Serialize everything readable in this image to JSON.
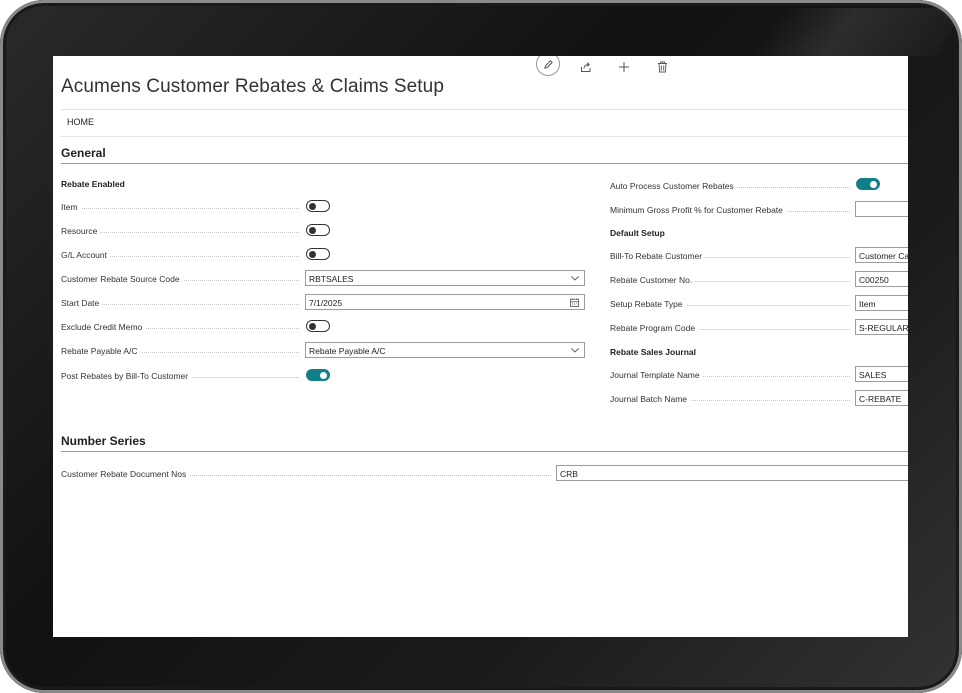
{
  "page": {
    "title": "Acumens Customer Rebates & Claims Setup",
    "tabs": [
      "HOME"
    ]
  },
  "toolbar": {
    "icons": [
      "edit-pencil-icon",
      "share-icon",
      "new-plus-icon",
      "delete-trash-icon"
    ]
  },
  "general": {
    "heading": "General",
    "left": {
      "group_heading": "Rebate Enabled",
      "item_label": "Item",
      "item_enabled": false,
      "resource_label": "Resource",
      "resource_enabled": false,
      "gl_account_label": "G/L Account",
      "gl_account_enabled": false,
      "source_code_label": "Customer Rebate Source Code",
      "source_code_value": "RBTSALES",
      "start_date_label": "Start Date",
      "start_date_value": "7/1/2025",
      "exclude_credit_memo_label": "Exclude Credit Memo",
      "exclude_credit_memo_enabled": false,
      "payable_ac_label": "Rebate Payable A/C",
      "payable_ac_value": "Rebate Payable A/C",
      "post_by_bill_to_label": "Post Rebates by Bill-To Customer",
      "post_by_bill_to_enabled": true
    },
    "right": {
      "auto_process_label": "Auto Process Customer Rebates",
      "auto_process_enabled": true,
      "min_gross_profit_label": "Minimum Gross Profit % for Customer Rebate",
      "min_gross_profit_value": "",
      "default_setup_heading": "Default Setup",
      "bill_to_label": "Bill-To Rebate Customer",
      "bill_to_value": "Customer Ca",
      "customer_no_label": "Rebate Customer No.",
      "customer_no_value": "C00250",
      "rebate_type_label": "Setup Rebate Type",
      "rebate_type_value": "Item",
      "program_code_label": "Rebate Program Code",
      "program_code_value": "S-REGULAR",
      "sales_journal_heading": "Rebate Sales Journal",
      "template_label": "Journal Template Name",
      "template_value": "SALES",
      "batch_label": "Journal Batch Name",
      "batch_value": "C-REBATE"
    }
  },
  "number_series": {
    "heading": "Number Series",
    "doc_nos_label": "Customer Rebate Document Nos",
    "doc_nos_value": "CRB"
  },
  "colors": {
    "accent": "#117f8a",
    "bezel": "#1a1a1a"
  }
}
